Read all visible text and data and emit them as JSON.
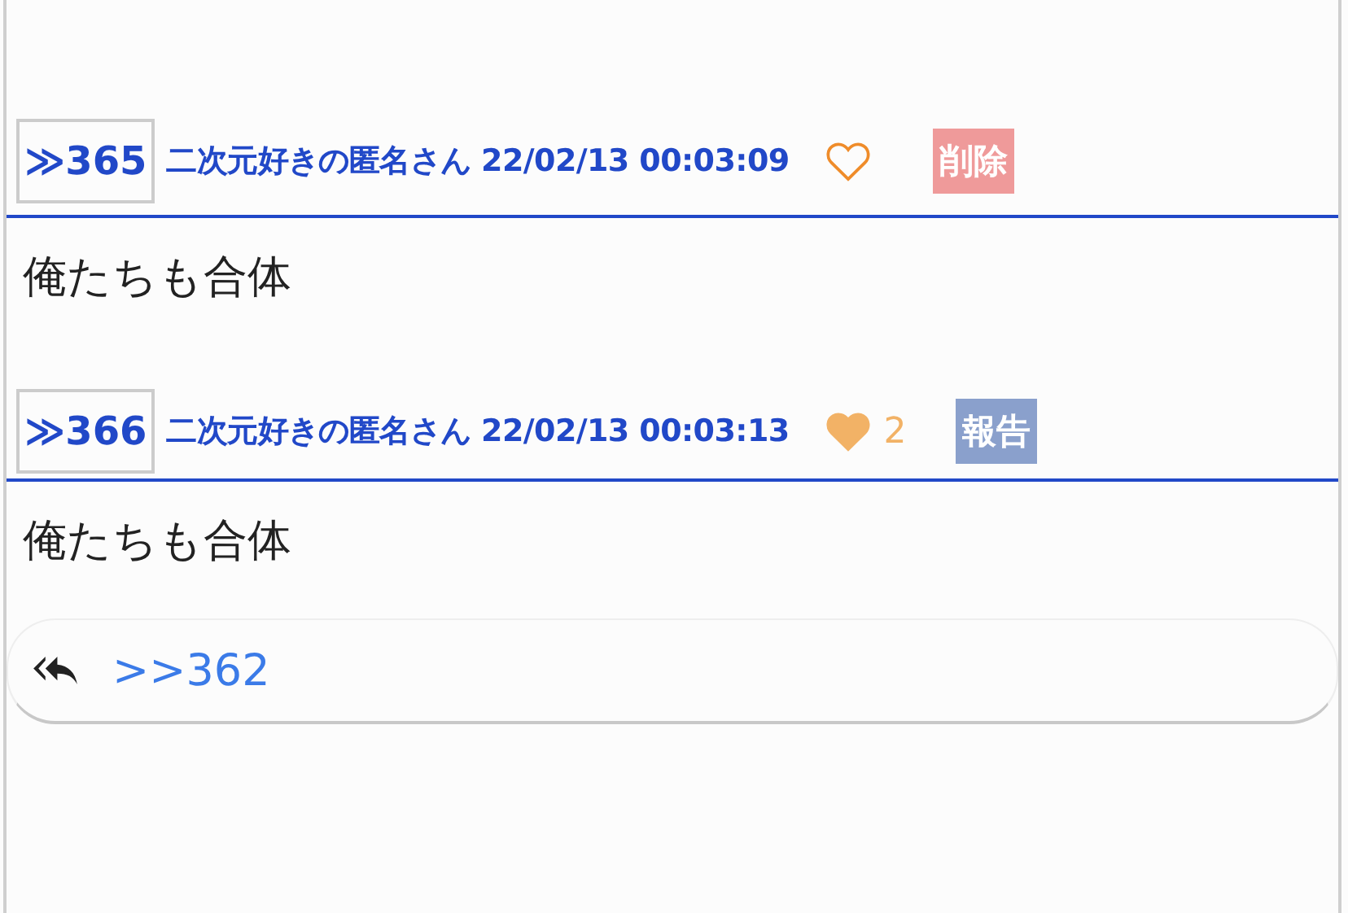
{
  "posts": [
    {
      "number": "≫365",
      "author_date": "二次元好きの匿名さん 22/02/13 00:03:09",
      "liked": false,
      "action": {
        "kind": "delete",
        "label": "削除"
      },
      "body": "俺たちも合体"
    },
    {
      "number": "≫366",
      "author_date": "二次元好きの匿名さん 22/02/13 00:03:13",
      "liked": true,
      "like_count": "2",
      "action": {
        "kind": "report",
        "label": "報告"
      },
      "body": "俺たちも合体",
      "reply_link": ">>362"
    }
  ]
}
